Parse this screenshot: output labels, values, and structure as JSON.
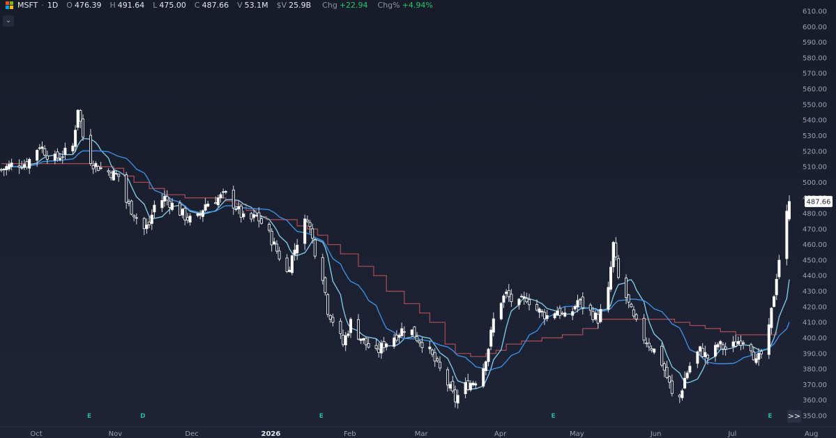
{
  "header": {
    "symbol": "MSFT",
    "interval": "1D",
    "open_label": "O",
    "open": "476.39",
    "high_label": "H",
    "high": "491.64",
    "low_label": "L",
    "low": "475.00",
    "close_label": "C",
    "close": "487.66",
    "volume_label": "V",
    "volume": "53.1M",
    "dollar_volume_label": "$V",
    "dollar_volume": "25.9B",
    "change_label": "Chg",
    "change": "+22.94",
    "change_pct_label": "Chg%",
    "change_pct": "+4.94%"
  },
  "controls": {
    "collapse_icon": "chevron-down-icon",
    "scroll_icon": "double-chevron-right-icon",
    "scroll_label": ">>"
  },
  "colors": {
    "up_candle": "#ffffff",
    "wick": "#d9dce3",
    "ma_fast": "#7ec8e3",
    "ma_slow": "#3d8ee0",
    "step_line": "#a34a52",
    "earnings_marker": "#2bb3a0",
    "axis_text": "#9aa1b0",
    "last_price_bg": "#ffffff",
    "last_price_text": "#1b2131"
  },
  "chart_data": {
    "type": "candlestick",
    "price_axis": {
      "position": "right",
      "ylim": [
        345,
        615
      ],
      "ticks": [
        "350.00",
        "360.00",
        "370.00",
        "380.00",
        "390.00",
        "400.00",
        "410.00",
        "420.00",
        "430.00",
        "440.00",
        "450.00",
        "460.00",
        "470.00",
        "480.00",
        "490.00",
        "500.00",
        "510.00",
        "520.00",
        "530.00",
        "540.00",
        "550.00",
        "560.00",
        "570.00",
        "580.00",
        "590.00",
        "600.00",
        "610.00"
      ],
      "last_price": "487.66",
      "last_price_value": 487.66
    },
    "time_axis": {
      "day_range": [
        0,
        312
      ],
      "labels": [
        {
          "text": "Oct",
          "day": 0
        },
        {
          "text": "Nov",
          "day": 31
        },
        {
          "text": "Dec",
          "day": 61
        },
        {
          "text": "2026",
          "day": 92,
          "bold": true
        },
        {
          "text": "Feb",
          "day": 123
        },
        {
          "text": "Mar",
          "day": 151
        },
        {
          "text": "Apr",
          "day": 182
        },
        {
          "text": "May",
          "day": 212
        },
        {
          "text": "Jun",
          "day": 243
        },
        {
          "text": "Jul",
          "day": 273
        },
        {
          "text": "Aug",
          "day": 304
        }
      ]
    },
    "event_markers": [
      {
        "text": "E",
        "day": 29
      },
      {
        "text": "D",
        "day": 50
      },
      {
        "text": "E",
        "day": 120
      },
      {
        "text": "E",
        "day": 211
      },
      {
        "text": "E",
        "day": 296
      }
    ],
    "price_keyframes": [
      [
        0,
        508
      ],
      [
        5,
        512
      ],
      [
        10,
        512
      ],
      [
        15,
        524
      ],
      [
        20,
        514
      ],
      [
        25,
        519
      ],
      [
        28,
        523
      ],
      [
        30,
        548
      ],
      [
        33,
        520
      ],
      [
        36,
        512
      ],
      [
        40,
        508
      ],
      [
        43,
        506
      ],
      [
        46,
        504
      ],
      [
        48,
        490
      ],
      [
        52,
        480
      ],
      [
        56,
        470
      ],
      [
        58,
        473
      ],
      [
        60,
        485
      ],
      [
        64,
        490
      ],
      [
        68,
        484
      ],
      [
        72,
        478
      ],
      [
        76,
        474
      ],
      [
        80,
        486
      ],
      [
        84,
        489
      ],
      [
        88,
        492
      ],
      [
        92,
        484
      ],
      [
        96,
        474
      ],
      [
        100,
        478
      ],
      [
        104,
        470
      ],
      [
        108,
        456
      ],
      [
        112,
        442
      ],
      [
        116,
        462
      ],
      [
        120,
        478
      ],
      [
        123,
        456
      ],
      [
        126,
        440
      ],
      [
        128,
        418
      ],
      [
        131,
        408
      ],
      [
        134,
        396
      ],
      [
        137,
        410
      ],
      [
        140,
        402
      ],
      [
        143,
        396
      ],
      [
        147,
        390
      ],
      [
        150,
        396
      ],
      [
        155,
        402
      ],
      [
        159,
        408
      ],
      [
        163,
        400
      ],
      [
        167,
        394
      ],
      [
        171,
        382
      ],
      [
        174,
        374
      ],
      [
        178,
        360
      ],
      [
        181,
        368
      ],
      [
        185,
        372
      ],
      [
        188,
        375
      ],
      [
        191,
        394
      ],
      [
        194,
        420
      ],
      [
        198,
        428
      ],
      [
        202,
        420
      ],
      [
        206,
        426
      ],
      [
        210,
        418
      ],
      [
        214,
        414
      ],
      [
        218,
        418
      ],
      [
        222,
        411
      ],
      [
        226,
        424
      ],
      [
        230,
        418
      ],
      [
        234,
        412
      ],
      [
        238,
        430
      ],
      [
        240,
        460
      ],
      [
        242,
        438
      ],
      [
        245,
        426
      ],
      [
        248,
        412
      ],
      [
        252,
        400
      ],
      [
        256,
        392
      ],
      [
        259,
        384
      ],
      [
        262,
        370
      ],
      [
        264,
        356
      ],
      [
        266,
        362
      ],
      [
        268,
        374
      ],
      [
        271,
        386
      ],
      [
        274,
        392
      ],
      [
        278,
        386
      ],
      [
        281,
        396
      ],
      [
        285,
        392
      ],
      [
        289,
        398
      ],
      [
        293,
        400
      ],
      [
        296,
        384
      ],
      [
        299,
        392
      ],
      [
        301,
        405
      ],
      [
        304,
        440
      ],
      [
        306,
        462
      ],
      [
        309,
        488
      ]
    ],
    "step_line": [
      [
        0,
        512
      ],
      [
        30,
        512
      ],
      [
        36,
        510
      ],
      [
        44,
        509
      ],
      [
        48,
        504
      ],
      [
        52,
        500
      ],
      [
        58,
        496
      ],
      [
        64,
        492
      ],
      [
        72,
        490
      ],
      [
        80,
        490
      ],
      [
        88,
        488
      ],
      [
        92,
        486
      ],
      [
        96,
        482
      ],
      [
        100,
        478
      ],
      [
        104,
        476
      ],
      [
        108,
        476
      ],
      [
        112,
        476
      ],
      [
        116,
        472
      ],
      [
        120,
        470
      ],
      [
        124,
        466
      ],
      [
        128,
        460
      ],
      [
        133,
        454
      ],
      [
        140,
        446
      ],
      [
        146,
        440
      ],
      [
        151,
        430
      ],
      [
        158,
        422
      ],
      [
        164,
        416
      ],
      [
        168,
        410
      ],
      [
        174,
        396
      ],
      [
        178,
        390
      ],
      [
        184,
        388
      ],
      [
        190,
        390
      ],
      [
        194,
        392
      ],
      [
        198,
        396
      ],
      [
        204,
        398
      ],
      [
        212,
        400
      ],
      [
        220,
        402
      ],
      [
        228,
        406
      ],
      [
        234,
        412
      ],
      [
        240,
        412
      ],
      [
        246,
        412
      ],
      [
        252,
        412
      ],
      [
        258,
        412
      ],
      [
        264,
        410
      ],
      [
        270,
        408
      ],
      [
        276,
        406
      ],
      [
        282,
        404
      ],
      [
        288,
        402
      ],
      [
        296,
        402
      ],
      [
        301,
        402
      ],
      [
        304,
        404
      ]
    ],
    "series": [
      {
        "name": "",
        "role": "fast",
        "window": 8
      },
      {
        "name": "",
        "role": "slow",
        "window": 21
      }
    ],
    "grid": false,
    "legend": "none"
  }
}
